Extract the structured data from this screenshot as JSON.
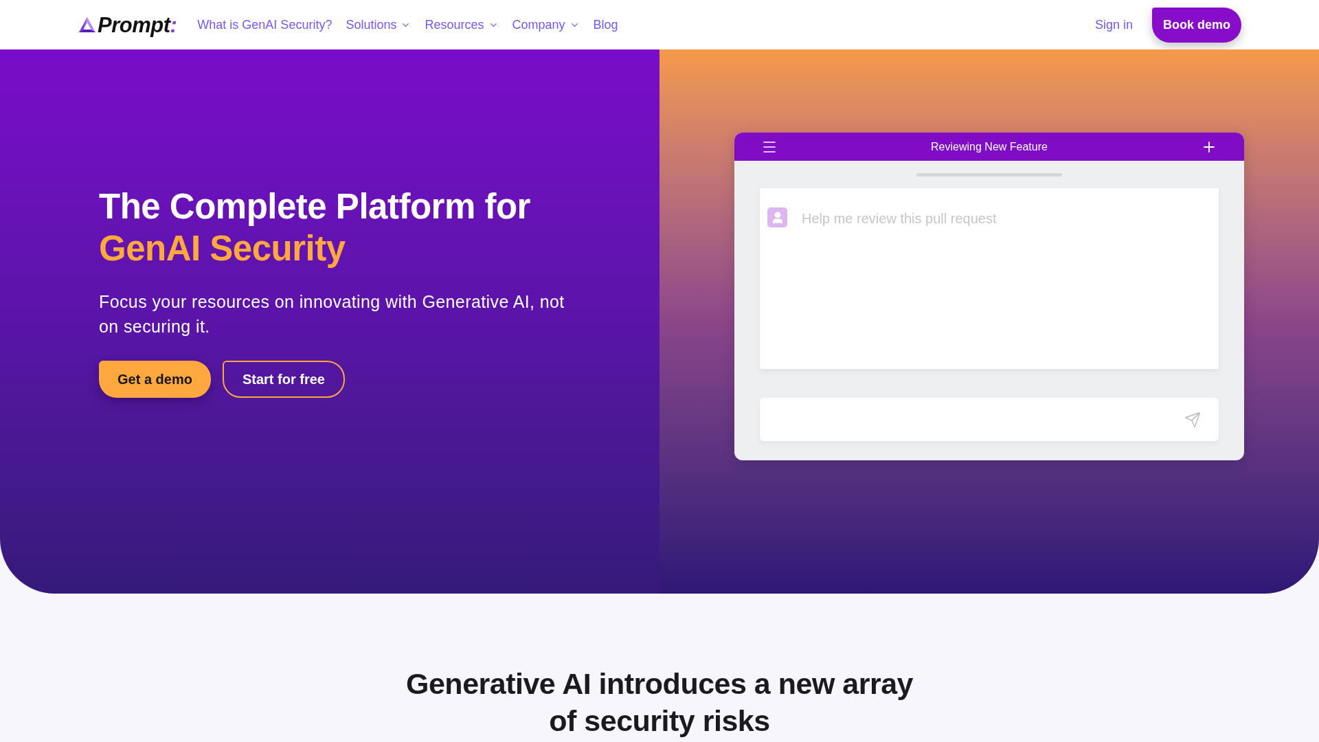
{
  "nav": {
    "logo": {
      "text": "Prompt",
      "accent": ":"
    },
    "links": [
      {
        "label": "What is GenAI Security?",
        "dropdown": false
      },
      {
        "label": "Solutions",
        "dropdown": true
      },
      {
        "label": "Resources",
        "dropdown": true
      },
      {
        "label": "Company",
        "dropdown": true
      },
      {
        "label": "Blog",
        "dropdown": false
      }
    ],
    "sign_in": "Sign in",
    "cta": "Book demo"
  },
  "hero": {
    "title": "The Complete Platform for",
    "title_highlight": "GenAI Security",
    "subtitle": "Focus your resources on innovating with Generative AI, not on securing it.",
    "buttons": [
      {
        "label": "Get a demo",
        "kind": "primary"
      },
      {
        "label": "Start for free",
        "kind": "outline"
      }
    ]
  },
  "chat_preview": {
    "title": "Reviewing New Feature",
    "message": "Help me review this pull request"
  },
  "section": {
    "heading": "Generative AI introduces a new array of security risks"
  }
}
